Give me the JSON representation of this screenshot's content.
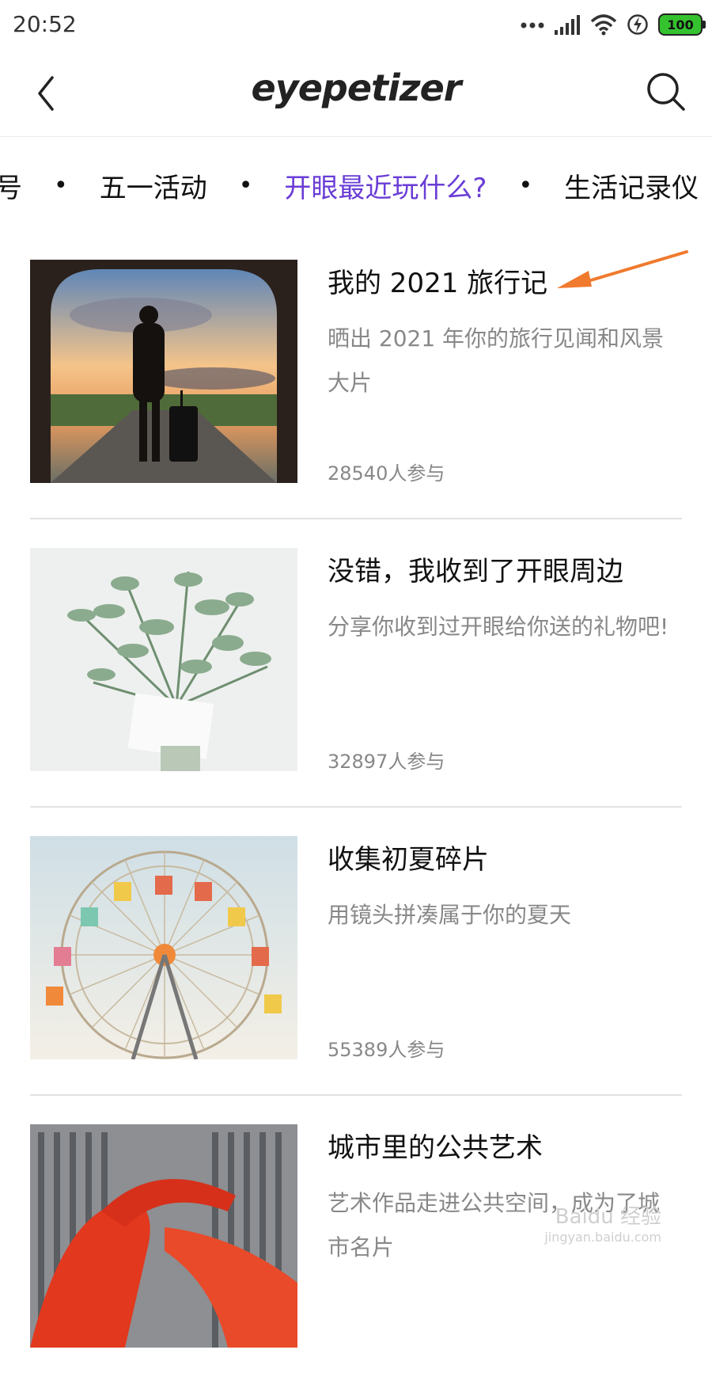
{
  "status": {
    "time": "20:52",
    "battery": "100"
  },
  "header": {
    "logo": "eyepetizer"
  },
  "tabs": [
    {
      "label": "号"
    },
    {
      "label": "五一活动"
    },
    {
      "label": "开眼最近玩什么?"
    },
    {
      "label": "生活记录仪"
    }
  ],
  "separator": "•",
  "active_tab_color": "#6a3dd6",
  "cards": [
    {
      "title": "我的 2021 旅行记",
      "desc": "晒出 2021 年你的旅行见闻和风景大片",
      "count": "28540人参与",
      "image": "traveler-silhouette"
    },
    {
      "title": "没错，我收到了开眼周边",
      "desc": "分享你收到过开眼给你送的礼物吧!",
      "count": "32897人参与",
      "image": "eucalyptus-bouquet"
    },
    {
      "title": "收集初夏碎片",
      "desc": "用镜头拼凑属于你的夏天",
      "count": "55389人参与",
      "image": "ferris-wheel"
    },
    {
      "title": "城市里的公共艺术",
      "desc": "艺术作品走进公共空间，成为了城市名片",
      "count": "",
      "image": "red-sculpture"
    }
  ],
  "annotation_arrow_color": "#f07a2e",
  "watermark": {
    "main": "Baidu 经验",
    "sub": "jingyan.baidu.com"
  }
}
